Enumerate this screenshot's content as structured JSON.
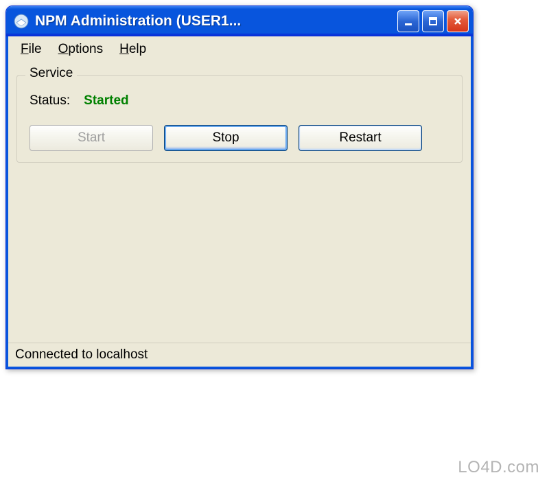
{
  "window": {
    "title": "NPM Administration (USER1..."
  },
  "menubar": {
    "file": "File",
    "options": "Options",
    "help": "Help"
  },
  "service": {
    "groupTitle": "Service",
    "statusLabel": "Status:",
    "statusValue": "Started",
    "buttons": {
      "start": "Start",
      "stop": "Stop",
      "restart": "Restart"
    }
  },
  "statusbar": {
    "text": "Connected to localhost"
  },
  "watermark": "LO4D.com"
}
